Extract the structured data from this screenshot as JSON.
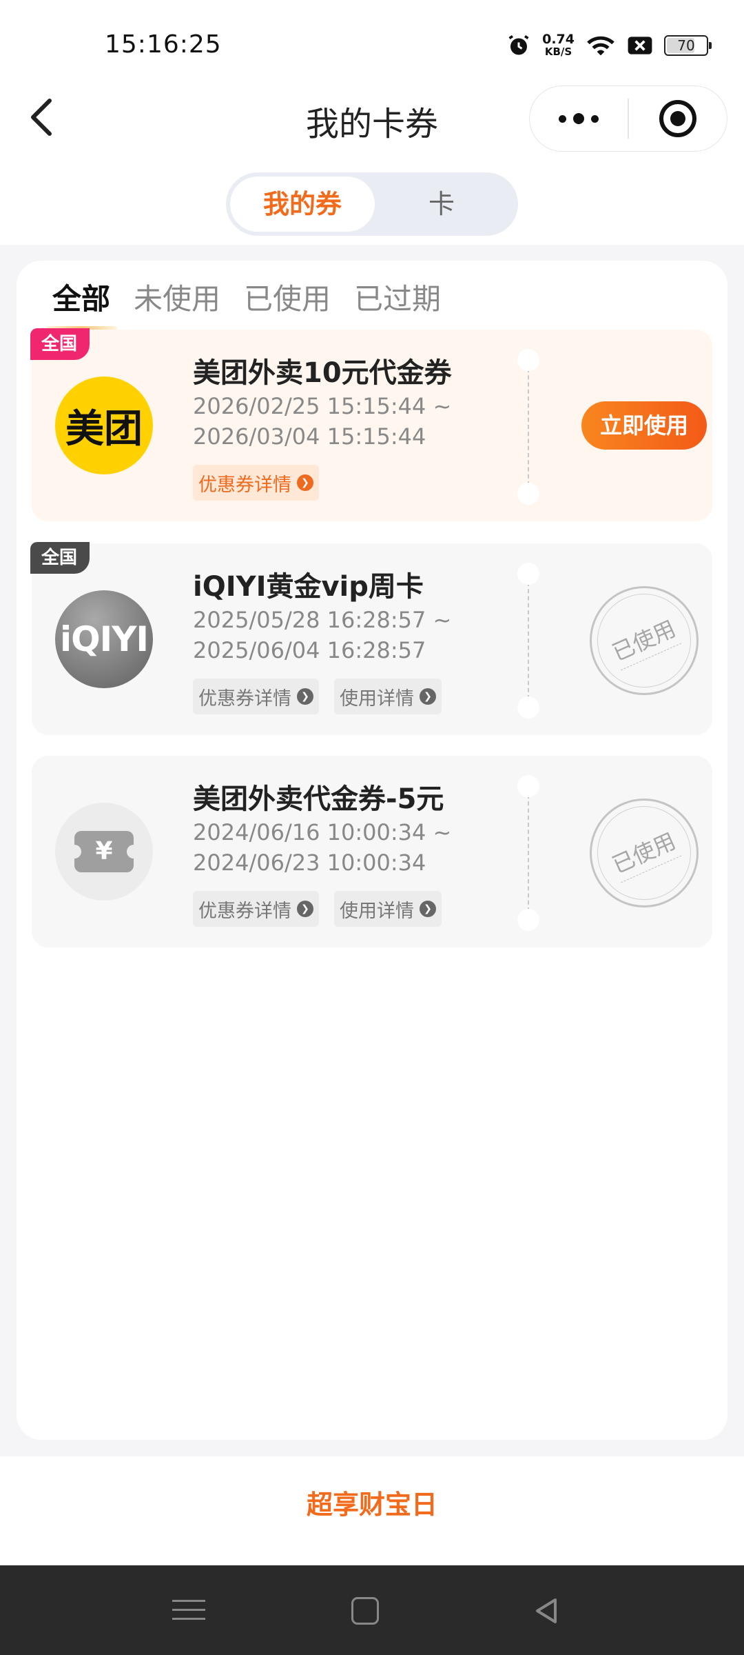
{
  "status_bar": {
    "time": "15:16:25",
    "net_speed": "0.74",
    "net_unit": "KB/S",
    "battery": "70"
  },
  "nav": {
    "title": "我的卡券"
  },
  "switcher": {
    "options": [
      "我的券",
      "卡"
    ],
    "active": "我的券"
  },
  "tabs": [
    "全部",
    "未使用",
    "已使用",
    "已过期"
  ],
  "coupons": [
    {
      "region": "全国",
      "logo_text": "美团",
      "title": "美团外卖10元代金券",
      "date_start": "2026/02/25 15:15:44 ~",
      "date_end": "2026/03/04 15:15:44",
      "chips": [
        "优惠券详情"
      ],
      "action": "立即使用"
    },
    {
      "region": "全国",
      "logo_text": "iQIYI",
      "title": "iQIYI黄金vip周卡",
      "date_start": "2025/05/28 16:28:57 ~",
      "date_end": "2025/06/04 16:28:57",
      "chips": [
        "优惠券详情",
        "使用详情"
      ],
      "stamp": "已使用"
    },
    {
      "logo_text": "¥",
      "title": "美团外卖代金券-5元",
      "date_start": "2024/06/16 10:00:34 ~",
      "date_end": "2024/06/23 10:00:34",
      "chips": [
        "优惠券详情",
        "使用详情"
      ],
      "stamp": "已使用"
    }
  ],
  "bottom_bar": {
    "label": "超享财宝日"
  },
  "colors": {
    "accent": "#f26b1d",
    "region_red": "#f0266e",
    "meituan_yellow": "#ffd100"
  }
}
